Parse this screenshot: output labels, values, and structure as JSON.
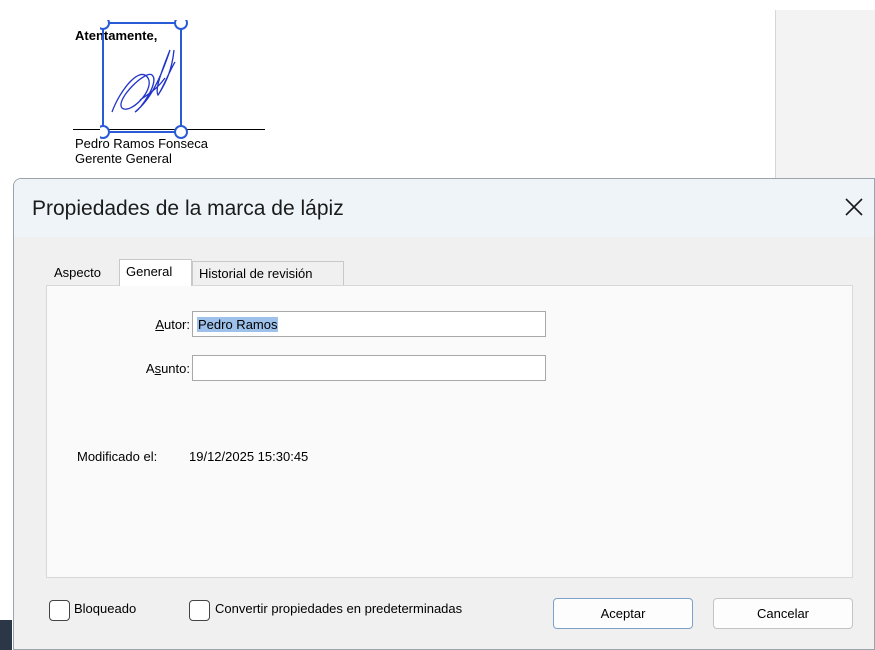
{
  "document": {
    "closing": "Atentamente,",
    "signer_name": "Pedro Ramos Fonseca",
    "signer_title": "Gerente General"
  },
  "dialog": {
    "title": "Propiedades de la marca de lápiz",
    "close_icon": "close-icon",
    "tabs": [
      {
        "label": "Aspecto",
        "active": false
      },
      {
        "label": "General",
        "active": true
      },
      {
        "label": "Historial de revisión",
        "active": false
      }
    ],
    "fields": {
      "autor_label_mnemonic": "A",
      "autor_label_rest": "utor:",
      "autor_value": "Pedro Ramos",
      "asunto_label_pre": "A",
      "asunto_label_mnemonic": "s",
      "asunto_label_rest": "unto:",
      "asunto_value": ""
    },
    "modified_label": "Modificado el:",
    "modified_value": "19/12/2025 15:30:45",
    "checkboxes": [
      {
        "label": "Bloqueado",
        "checked": false
      },
      {
        "label": "Convertir propiedades en predeterminadas",
        "checked": false
      }
    ],
    "buttons": {
      "ok": "Aceptar",
      "cancel": "Cancelar"
    }
  }
}
